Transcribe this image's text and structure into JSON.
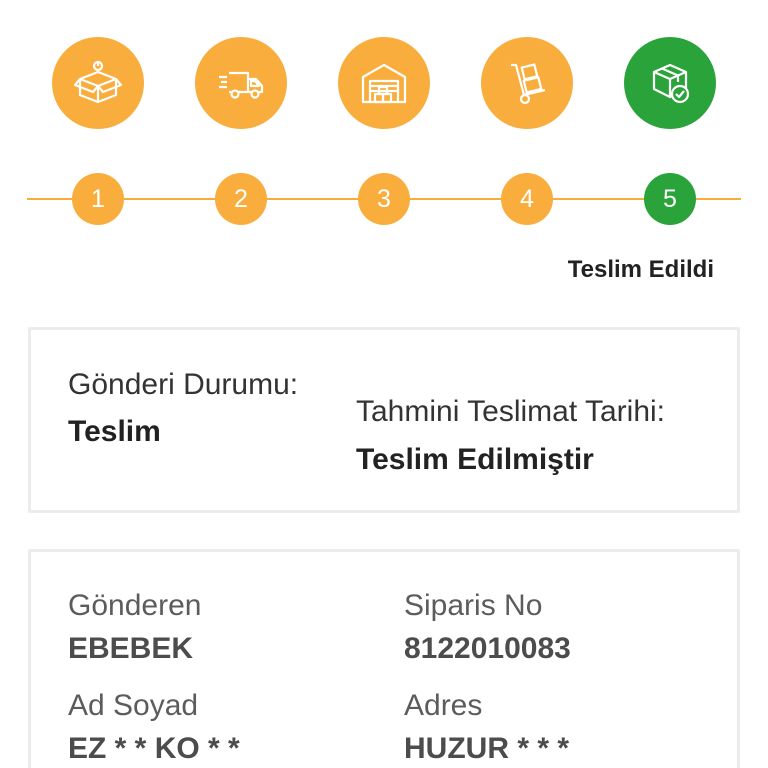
{
  "steps": [
    {
      "number": "1",
      "icon": "open-box-icon",
      "color": "#f8ad3d"
    },
    {
      "number": "2",
      "icon": "delivery-truck-icon",
      "color": "#f8ad3d"
    },
    {
      "number": "3",
      "icon": "warehouse-icon",
      "color": "#f8ad3d"
    },
    {
      "number": "4",
      "icon": "hand-truck-icon",
      "color": "#f8ad3d"
    },
    {
      "number": "5",
      "icon": "delivered-package-check-icon",
      "color": "#2aa43a"
    }
  ],
  "status_label": "Teslim Edildi",
  "shipment_card": {
    "status_label": "Gönderi Durumu:",
    "status_value": "Teslim",
    "eta_label": "Tahmini Teslimat Tarihi:",
    "eta_value": "Teslim Edilmiştir"
  },
  "details_card": {
    "sender_label": "Gönderen",
    "sender_value": "EBEBEK",
    "order_label": "Siparis No",
    "order_value": "8122010083",
    "name_label": "Ad Soyad",
    "name_value": "EZ * * KO * *",
    "address_label": "Adres",
    "address_value": "HUZUR * * *"
  },
  "colors": {
    "accent": "#f8ad3d",
    "complete": "#2aa43a"
  }
}
